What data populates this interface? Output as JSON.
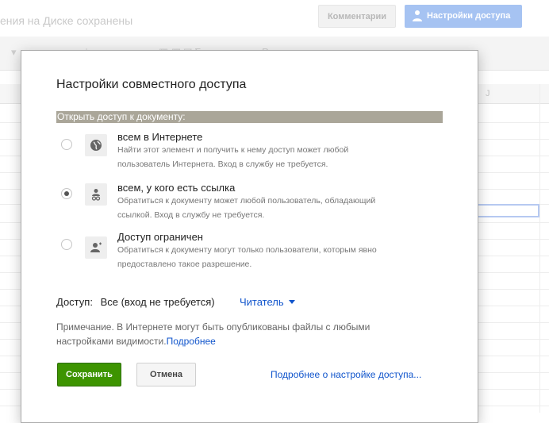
{
  "background": {
    "saved_status": "ения на Диске сохранены",
    "comments_button": "Комментарии",
    "share_button": "Настройки доступа",
    "column_label": "J",
    "toolbar_fragment": "Ру"
  },
  "dialog": {
    "title": "Настройки совместного доступа",
    "section_label": "Открыть доступ к документу:",
    "options": [
      {
        "title": "всем в Интернете",
        "desc_line1": "Найти этот элемент и получить к нему доступ может любой",
        "desc_line2": "пользователь Интернета. Вход в службу не требуется.",
        "icon": "globe-icon",
        "checked": false
      },
      {
        "title": "всем, у кого есть ссылка",
        "desc_line1": "Обратиться к документу может любой пользователь, обладающий",
        "desc_line2": "ссылкой. Вход в службу не требуется.",
        "icon": "link-person-icon",
        "checked": true
      },
      {
        "title": "Доступ ограничен",
        "desc_line1": "Обратиться к документу могут только пользователи, которым явно",
        "desc_line2": "предоставлено такое разрешение.",
        "icon": "person-icon",
        "checked": false
      }
    ],
    "access_label": "Доступ:",
    "access_value": "Все (вход не требуется)",
    "role_dropdown": "Читатель",
    "note_text": "Примечание. В Интернете могут быть опубликованы файлы с любыми настройками видимости.",
    "note_link": "Подробнее",
    "save_button": "Сохранить",
    "cancel_button": "Отмена",
    "more_link": "Подробнее о настройке доступа..."
  },
  "colors": {
    "section_bar": "#aaa699",
    "save_green": "#3d9400",
    "link_blue": "#1155cc",
    "share_blue": "#a6c3f2"
  }
}
